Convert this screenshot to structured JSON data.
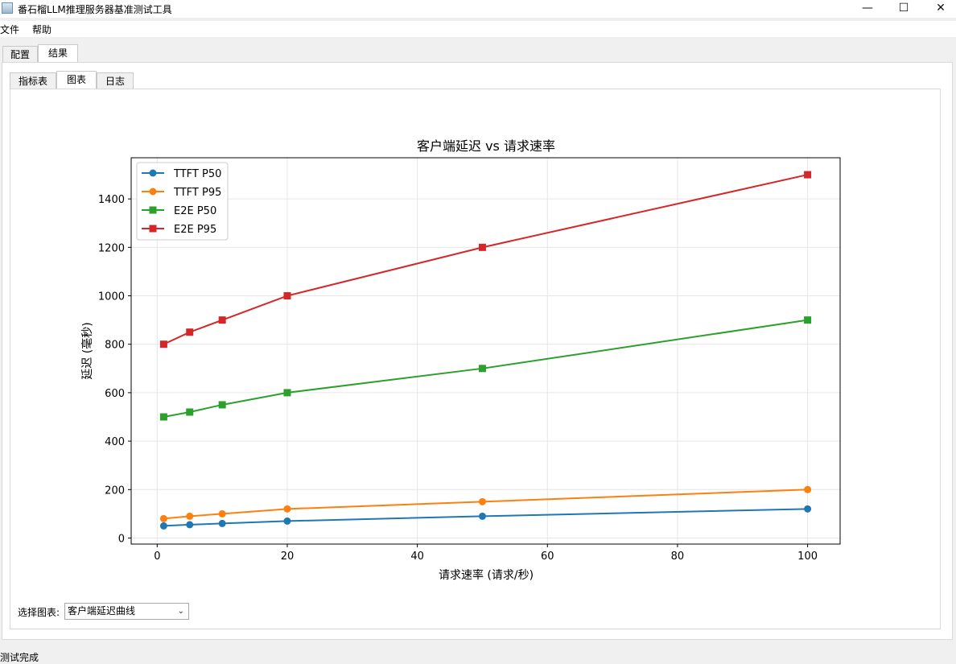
{
  "window": {
    "title": "番石榴LLM推理服务器基准测试工具",
    "minimize": "—",
    "maximize": "☐",
    "close": "✕"
  },
  "menu": [
    "文件",
    "帮助"
  ],
  "outer_tabs": [
    {
      "label": "配置",
      "active": false
    },
    {
      "label": "结果",
      "active": true
    }
  ],
  "inner_tabs": [
    {
      "label": "指标表",
      "active": false
    },
    {
      "label": "图表",
      "active": true
    },
    {
      "label": "日志",
      "active": false
    }
  ],
  "chart_select": {
    "label": "选择图表:",
    "value": "客户端延迟曲线"
  },
  "status": "测试完成",
  "chart_data": {
    "type": "line",
    "title": "客户端延迟 vs 请求速率",
    "xlabel": "请求速率 (请求/秒)",
    "ylabel": "延迟 (毫秒)",
    "xlim": [
      -4,
      105
    ],
    "ylim": [
      -25,
      1570
    ],
    "xticks": [
      0,
      20,
      40,
      60,
      80,
      100
    ],
    "yticks": [
      0,
      200,
      400,
      600,
      800,
      1000,
      1200,
      1400
    ],
    "grid": true,
    "legend_position": "top-left",
    "x": [
      1,
      5,
      10,
      20,
      50,
      100
    ],
    "series": [
      {
        "name": "TTFT P50",
        "color": "#1f77b4",
        "marker": "circle",
        "values": [
          50,
          55,
          60,
          70,
          90,
          120
        ]
      },
      {
        "name": "TTFT P95",
        "color": "#ff7f0e",
        "marker": "circle",
        "values": [
          80,
          90,
          100,
          120,
          150,
          200
        ]
      },
      {
        "name": "E2E P50",
        "color": "#2ca02c",
        "marker": "square",
        "values": [
          500,
          520,
          550,
          600,
          700,
          900
        ]
      },
      {
        "name": "E2E P95",
        "color": "#d62728",
        "marker": "square",
        "values": [
          800,
          850,
          900,
          1000,
          1200,
          1500
        ]
      }
    ]
  }
}
